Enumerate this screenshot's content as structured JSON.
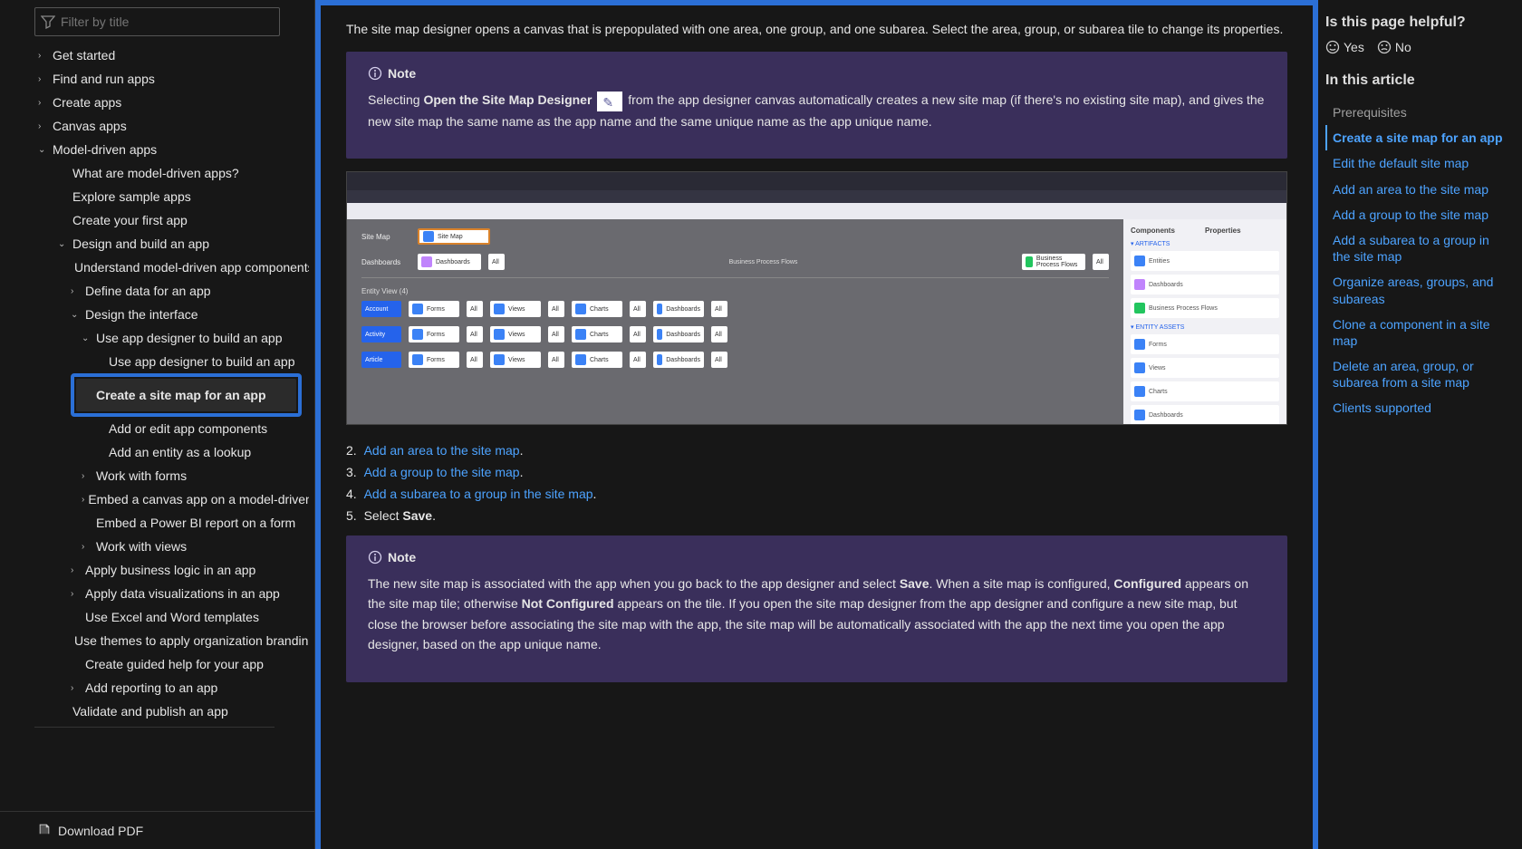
{
  "filter": {
    "placeholder": "Filter by title"
  },
  "nav": {
    "items": [
      {
        "level": 0,
        "chev": "›",
        "label": "Get started"
      },
      {
        "level": 0,
        "chev": "›",
        "label": "Find and run apps"
      },
      {
        "level": 0,
        "chev": "›",
        "label": "Create apps"
      },
      {
        "level": 0,
        "chev": "›",
        "label": "Canvas apps"
      },
      {
        "level": 0,
        "chev": "⌄",
        "label": "Model-driven apps"
      },
      {
        "level": 1,
        "chev": "",
        "label": "What are model-driven apps?"
      },
      {
        "level": 1,
        "chev": "",
        "label": "Explore sample apps"
      },
      {
        "level": 1,
        "chev": "",
        "label": "Create your first app"
      },
      {
        "level": 1,
        "chev": "⌄",
        "label": "Design and build an app"
      },
      {
        "level": 2,
        "chev": "",
        "label": "Understand model-driven app components"
      },
      {
        "level": 2,
        "chev": "›",
        "label": "Define data for an app"
      },
      {
        "level": 2,
        "chev": "⌄",
        "label": "Design the interface"
      },
      {
        "level": 3,
        "chev": "⌄",
        "label": "Use app designer to build an app"
      },
      {
        "level": 4,
        "chev": "",
        "label": "Use app designer to build an app"
      },
      {
        "level": 4,
        "chev": "",
        "label": "Add or edit app components"
      },
      {
        "level": 4,
        "chev": "",
        "label": "Add an entity as a lookup"
      },
      {
        "level": 3,
        "chev": "›",
        "label": "Work with forms"
      },
      {
        "level": 3,
        "chev": "›",
        "label": "Embed a canvas app on a model-driven form"
      },
      {
        "level": 3,
        "chev": "",
        "label": "Embed a Power BI report on a form"
      },
      {
        "level": 3,
        "chev": "›",
        "label": "Work with views"
      },
      {
        "level": 2,
        "chev": "›",
        "label": "Apply business logic in an app"
      },
      {
        "level": 2,
        "chev": "›",
        "label": "Apply data visualizations in an app"
      },
      {
        "level": 2,
        "chev": "",
        "label": "Use Excel and Word templates"
      },
      {
        "level": 2,
        "chev": "",
        "label": "Use themes to apply organization branding"
      },
      {
        "level": 2,
        "chev": "",
        "label": "Create guided help for your app"
      },
      {
        "level": 2,
        "chev": "›",
        "label": "Add reporting to an app"
      },
      {
        "level": 1,
        "chev": "",
        "label": "Validate and publish an app"
      }
    ],
    "active": "Create a site map for an app",
    "download": "Download PDF"
  },
  "content": {
    "intro": "The site map designer opens a canvas that is prepopulated with one area, one group, and one subarea. Select the area, group, or subarea tile to change its properties.",
    "note1_title": "Note",
    "note1_a": "Selecting ",
    "note1_b": "Open the Site Map Designer",
    "note1_c": " from the app designer canvas automatically creates a new site map (if there's no existing site map), and gives the new site map the same name as the app name and the same unique name as the app unique name.",
    "steps": {
      "s2n": "2. ",
      "s2a": "Add an area to the site map",
      "s2b": ".",
      "s3n": "3. ",
      "s3a": "Add a group to the site map",
      "s3b": ".",
      "s4n": "4. ",
      "s4a": "Add a subarea to a group in the site map",
      "s4b": ".",
      "s5n": "5. ",
      "s5a": "Select ",
      "s5b": "Save",
      "s5c": "."
    },
    "note2_title": "Note",
    "note2_a": "The new site map is associated with the app when you go back to the app designer and select ",
    "note2_b": "Save",
    "note2_c": ". When a site map is configured, ",
    "note2_d": "Configured",
    "note2_e": " appears on the site map tile; otherwise ",
    "note2_f": "Not Configured",
    "note2_g": " appears on the tile. If you open the site map designer from the app designer and configure a new site map, but close the browser before associating the site map with the app, the site map will be automatically associated with the app the next time you open the app designer, based on the app unique name."
  },
  "screenshot_labels": {
    "sitemap": "Site Map",
    "sitemap_tile": "Site Map",
    "dashboards": "Dashboards",
    "bpf": "Business Process Flows",
    "entity_view": "Entity View (4)",
    "account": "Account",
    "activity": "Activity",
    "article": "Article",
    "forms": "Forms",
    "views": "Views",
    "charts": "Charts",
    "dash": "Dashboards",
    "all": "All",
    "components": "Components",
    "properties": "Properties",
    "artifacts": "ARTIFACTS",
    "entities": "Entities",
    "r_dash": "Dashboards",
    "r_bpf": "Business Process Flows",
    "entity_assets": "ENTITY ASSETS",
    "r_forms": "Forms",
    "r_views": "Views",
    "r_charts": "Charts",
    "r_dash2": "Dashboards"
  },
  "rail": {
    "helpful": "Is this page helpful?",
    "yes": "Yes",
    "no": "No",
    "in_article": "In this article",
    "toc": [
      {
        "label": "Prerequisites",
        "active": false,
        "muted": true
      },
      {
        "label": "Create a site map for an app",
        "active": true
      },
      {
        "label": "Edit the default site map",
        "active": false
      },
      {
        "label": "Add an area to the site map",
        "active": false
      },
      {
        "label": "Add a group to the site map",
        "active": false
      },
      {
        "label": "Add a subarea to a group in the site map",
        "active": false
      },
      {
        "label": "Organize areas, groups, and subareas",
        "active": false
      },
      {
        "label": "Clone a component in a site map",
        "active": false
      },
      {
        "label": "Delete an area, group, or subarea from a site map",
        "active": false
      },
      {
        "label": "Clients supported",
        "active": false
      }
    ]
  }
}
